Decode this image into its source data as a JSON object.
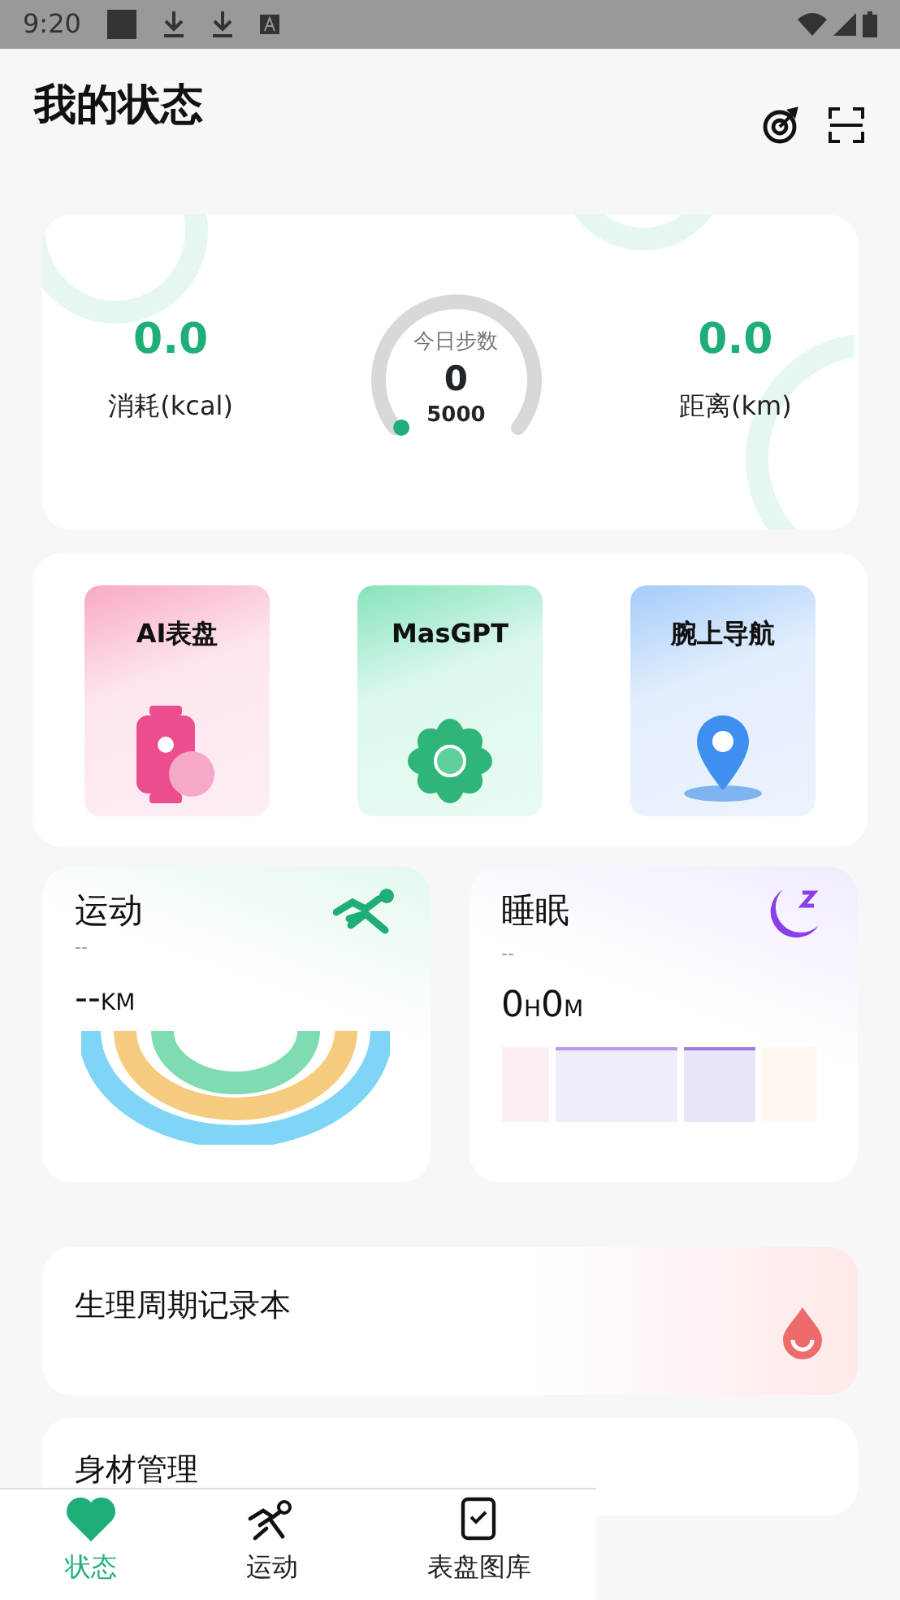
{
  "status_bar": {
    "time": "9:20"
  },
  "header": {
    "title": "我的状态"
  },
  "summary": {
    "left": {
      "value": "0.0",
      "label": "消耗(kcal)"
    },
    "gauge": {
      "title": "今日步数",
      "value": "0",
      "goal": "5000"
    },
    "right": {
      "value": "0.0",
      "label": "距离(km)"
    }
  },
  "shortcuts": [
    {
      "label": "AI表盘",
      "kind": "watch"
    },
    {
      "label": "MasGPT",
      "kind": "gpt"
    },
    {
      "label": "腕上导航",
      "kind": "nav"
    }
  ],
  "sport": {
    "title": "运动",
    "subtitle": "--",
    "segments": [
      {
        "text": "--",
        "kind": "num"
      },
      {
        "text": "KM",
        "kind": "unit"
      }
    ]
  },
  "sleep": {
    "title": "睡眠",
    "subtitle": "--",
    "segments": [
      {
        "text": "0",
        "kind": "num"
      },
      {
        "text": "H",
        "kind": "unit"
      },
      {
        "text": "0",
        "kind": "num"
      },
      {
        "text": "M",
        "kind": "unit"
      }
    ]
  },
  "period": {
    "title": "生理周期记录本"
  },
  "body": {
    "title": "身材管理"
  },
  "tabs": [
    {
      "label": "状态",
      "kind": "status",
      "selected": true
    },
    {
      "label": "运动",
      "kind": "sport",
      "selected": false
    },
    {
      "label": "表盘图库",
      "kind": "faces",
      "selected": false
    }
  ]
}
